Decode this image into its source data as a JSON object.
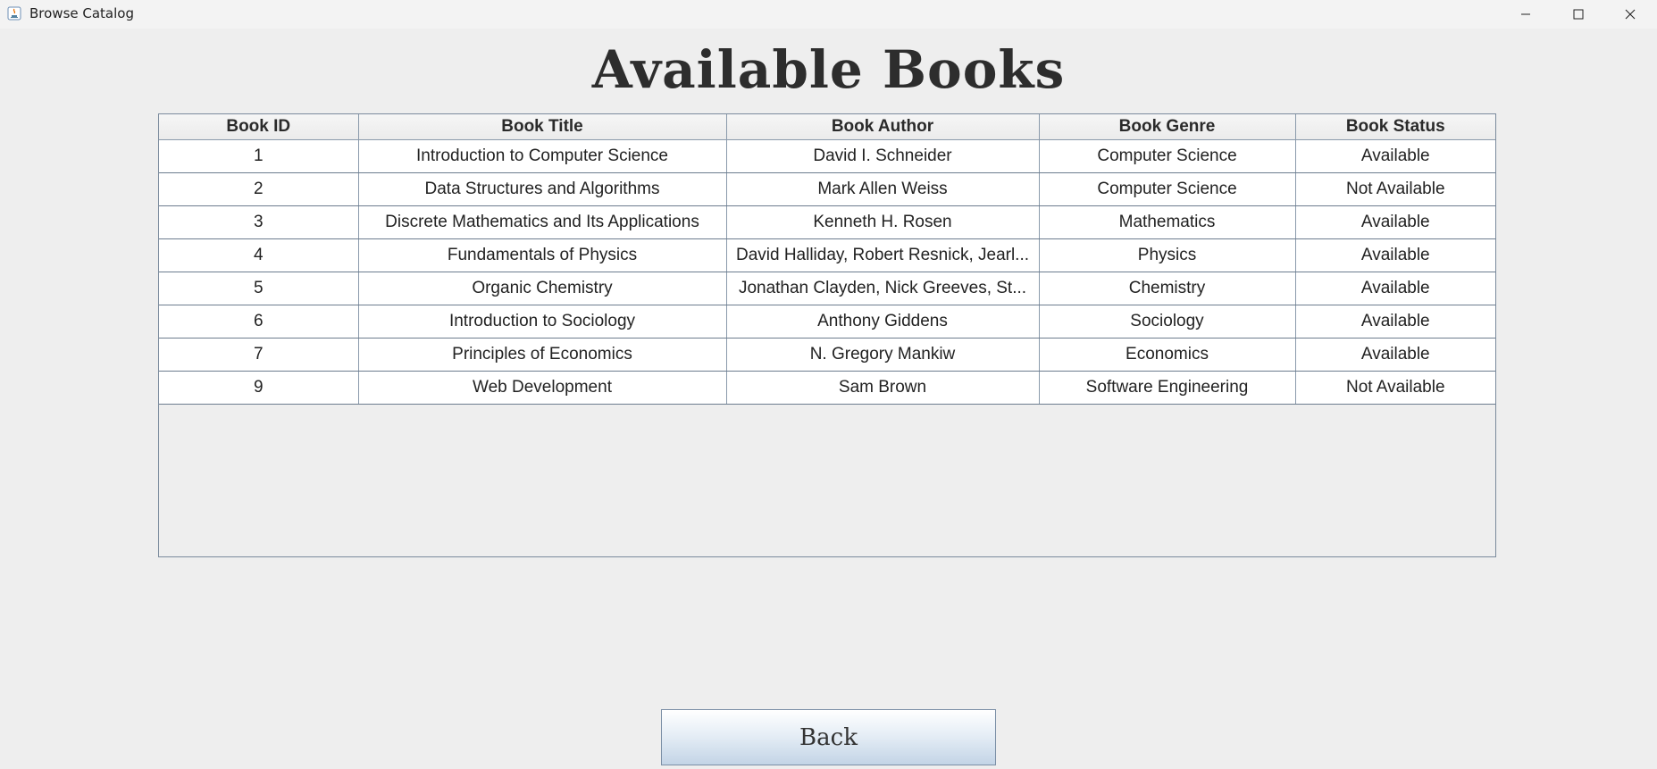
{
  "window": {
    "title": "Browse Catalog"
  },
  "page": {
    "heading": "Available Books"
  },
  "table": {
    "columns": [
      "Book ID",
      "Book Title",
      "Book Author",
      "Book Genre",
      "Book Status"
    ],
    "rows": [
      [
        "1",
        "Introduction to Computer Science",
        "David I. Schneider",
        "Computer Science",
        "Available"
      ],
      [
        "2",
        "Data Structures and Algorithms",
        "Mark Allen Weiss",
        "Computer Science",
        "Not Available"
      ],
      [
        "3",
        "Discrete Mathematics and Its Applications",
        "Kenneth H. Rosen",
        "Mathematics",
        "Available"
      ],
      [
        "4",
        "Fundamentals of Physics",
        "David Halliday, Robert Resnick, Jearl...",
        "Physics",
        "Available"
      ],
      [
        "5",
        "Organic Chemistry",
        "Jonathan Clayden, Nick Greeves, St...",
        "Chemistry",
        "Available"
      ],
      [
        "6",
        "Introduction to Sociology",
        "Anthony Giddens",
        "Sociology",
        "Available"
      ],
      [
        "7",
        "Principles of Economics",
        "N. Gregory Mankiw",
        "Economics",
        "Available"
      ],
      [
        "9",
        "Web Development",
        "Sam Brown",
        "Software Engineering",
        "Not Available"
      ]
    ]
  },
  "buttons": {
    "back_label": "Back"
  },
  "icons": {
    "app": "java-app-icon",
    "minimize": "minimize-icon",
    "maximize": "maximize-icon",
    "close": "close-icon"
  },
  "colors": {
    "window_bg": "#eeeeee",
    "heading": "#2d2d2d",
    "table_border": "#7a8a9c",
    "button_gradient_bottom": "#c3d4e6"
  }
}
